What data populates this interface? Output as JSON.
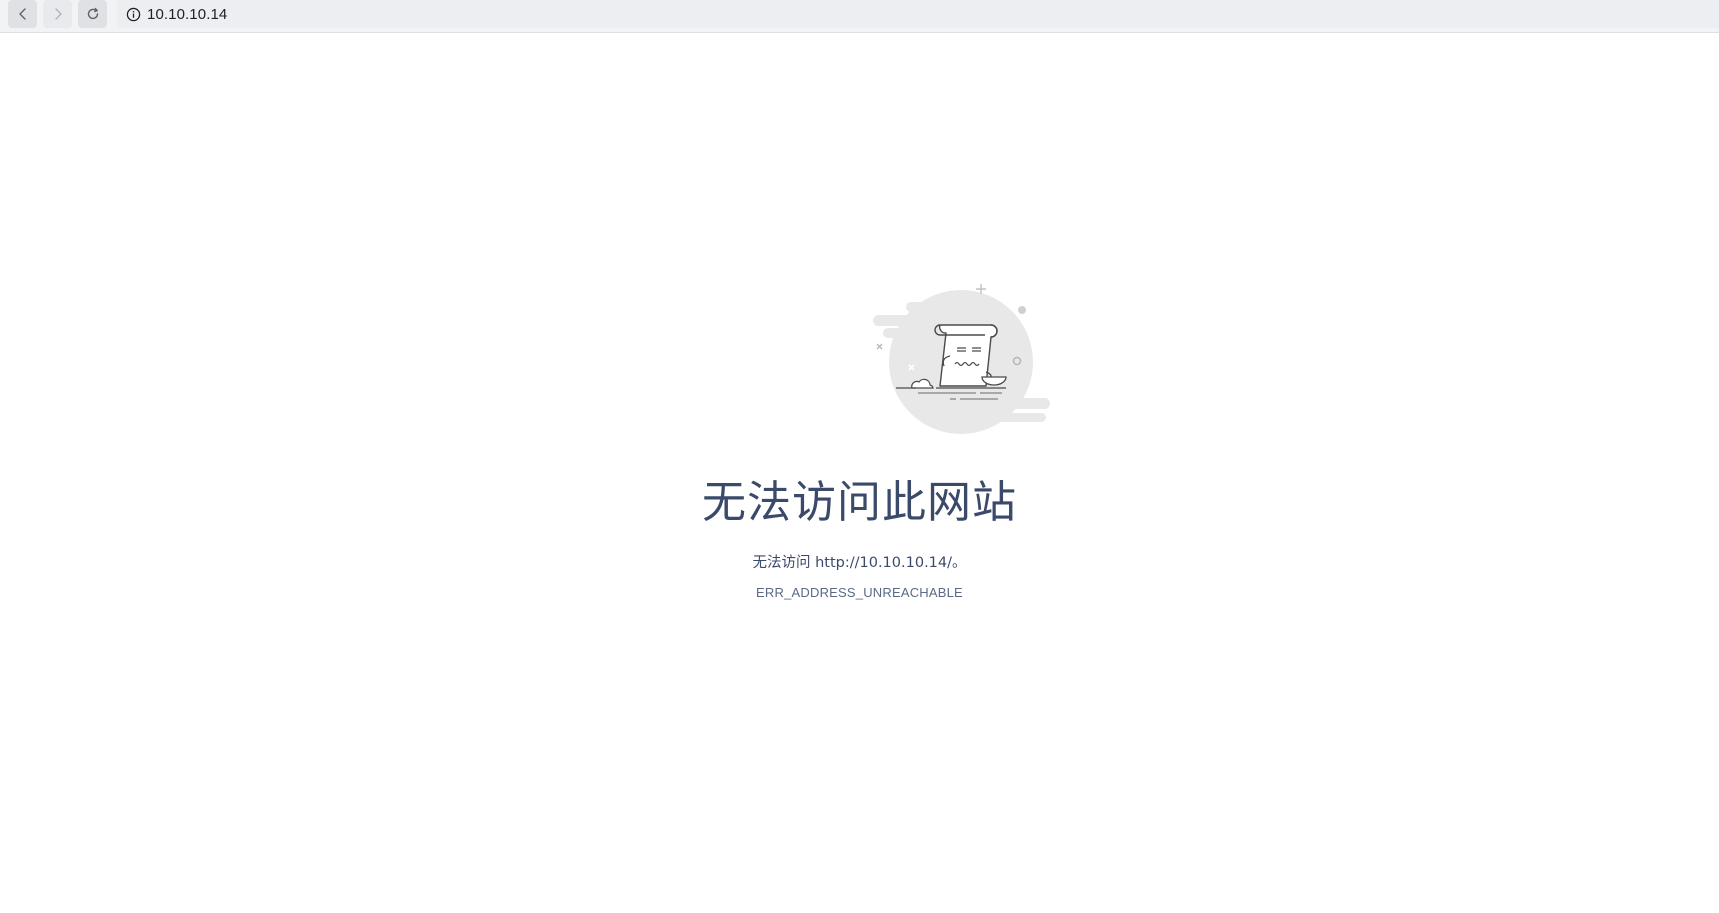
{
  "browser": {
    "url": "10.10.10.14",
    "buttons": {
      "back_icon": "chevron-left-icon",
      "forward_icon": "chevron-right-icon",
      "reload_icon": "reload-icon",
      "info_icon": "info-icon"
    }
  },
  "error_page": {
    "title": "无法访问此网站",
    "detail": "无法访问 http://10.10.10.14/。",
    "code": "ERR_ADDRESS_UNREACHABLE",
    "illustration": "broken-page-illustration"
  },
  "colors": {
    "text_primary": "#3b4a6b",
    "text_secondary": "#5a6a86",
    "toolbar_bg": "#f2f3f5"
  }
}
